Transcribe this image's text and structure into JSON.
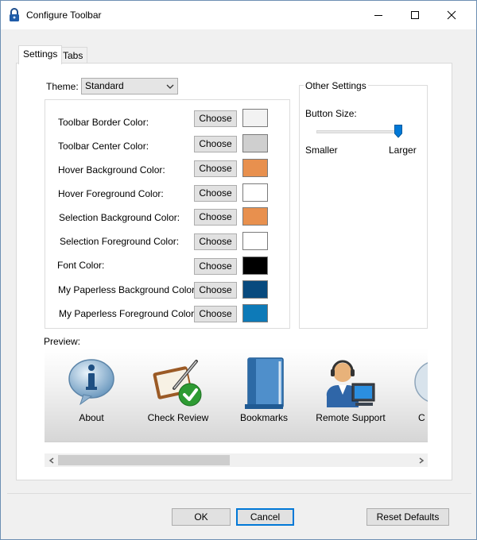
{
  "window": {
    "title": "Configure Toolbar"
  },
  "tabs": [
    {
      "label": "Settings",
      "active": true
    },
    {
      "label": "Tabs",
      "active": false
    }
  ],
  "theme": {
    "label": "Theme:",
    "value": "Standard"
  },
  "color_settings": [
    {
      "label": "Toolbar Border Color:",
      "button": "Choose",
      "color": "#f2f2f2"
    },
    {
      "label": "Toolbar Center Color:",
      "button": "Choose",
      "color": "#cfcfcf"
    },
    {
      "label": "Hover Background Color:",
      "button": "Choose",
      "color": "#e8904e"
    },
    {
      "label": "Hover Foreground Color:",
      "button": "Choose",
      "color": "#ffffff"
    },
    {
      "label": "Selection Background Color:",
      "button": "Choose",
      "color": "#e8904e"
    },
    {
      "label": "Selection Foreground Color:",
      "button": "Choose",
      "color": "#ffffff"
    },
    {
      "label": "Font Color:",
      "button": "Choose",
      "color": "#000000"
    },
    {
      "label": "My Paperless Background Color:",
      "button": "Choose",
      "color": "#084a7e"
    },
    {
      "label": "My Paperless Foreground Color:",
      "button": "Choose",
      "color": "#0d7ab8"
    }
  ],
  "other_settings": {
    "title": "Other Settings",
    "button_size_label": "Button Size:",
    "min_label": "Smaller",
    "max_label": "Larger",
    "button_size_level": 1.0
  },
  "preview": {
    "label": "Preview:",
    "items": [
      {
        "label": "About",
        "icon": "info-icon"
      },
      {
        "label": "Check Review",
        "icon": "check-review-icon"
      },
      {
        "label": "Bookmarks",
        "icon": "book-icon"
      },
      {
        "label": "Remote Support",
        "icon": "remote-support-icon"
      },
      {
        "label": "C",
        "icon": "partial-icon"
      }
    ]
  },
  "buttons": {
    "ok": "OK",
    "cancel": "Cancel",
    "reset": "Reset Defaults"
  }
}
